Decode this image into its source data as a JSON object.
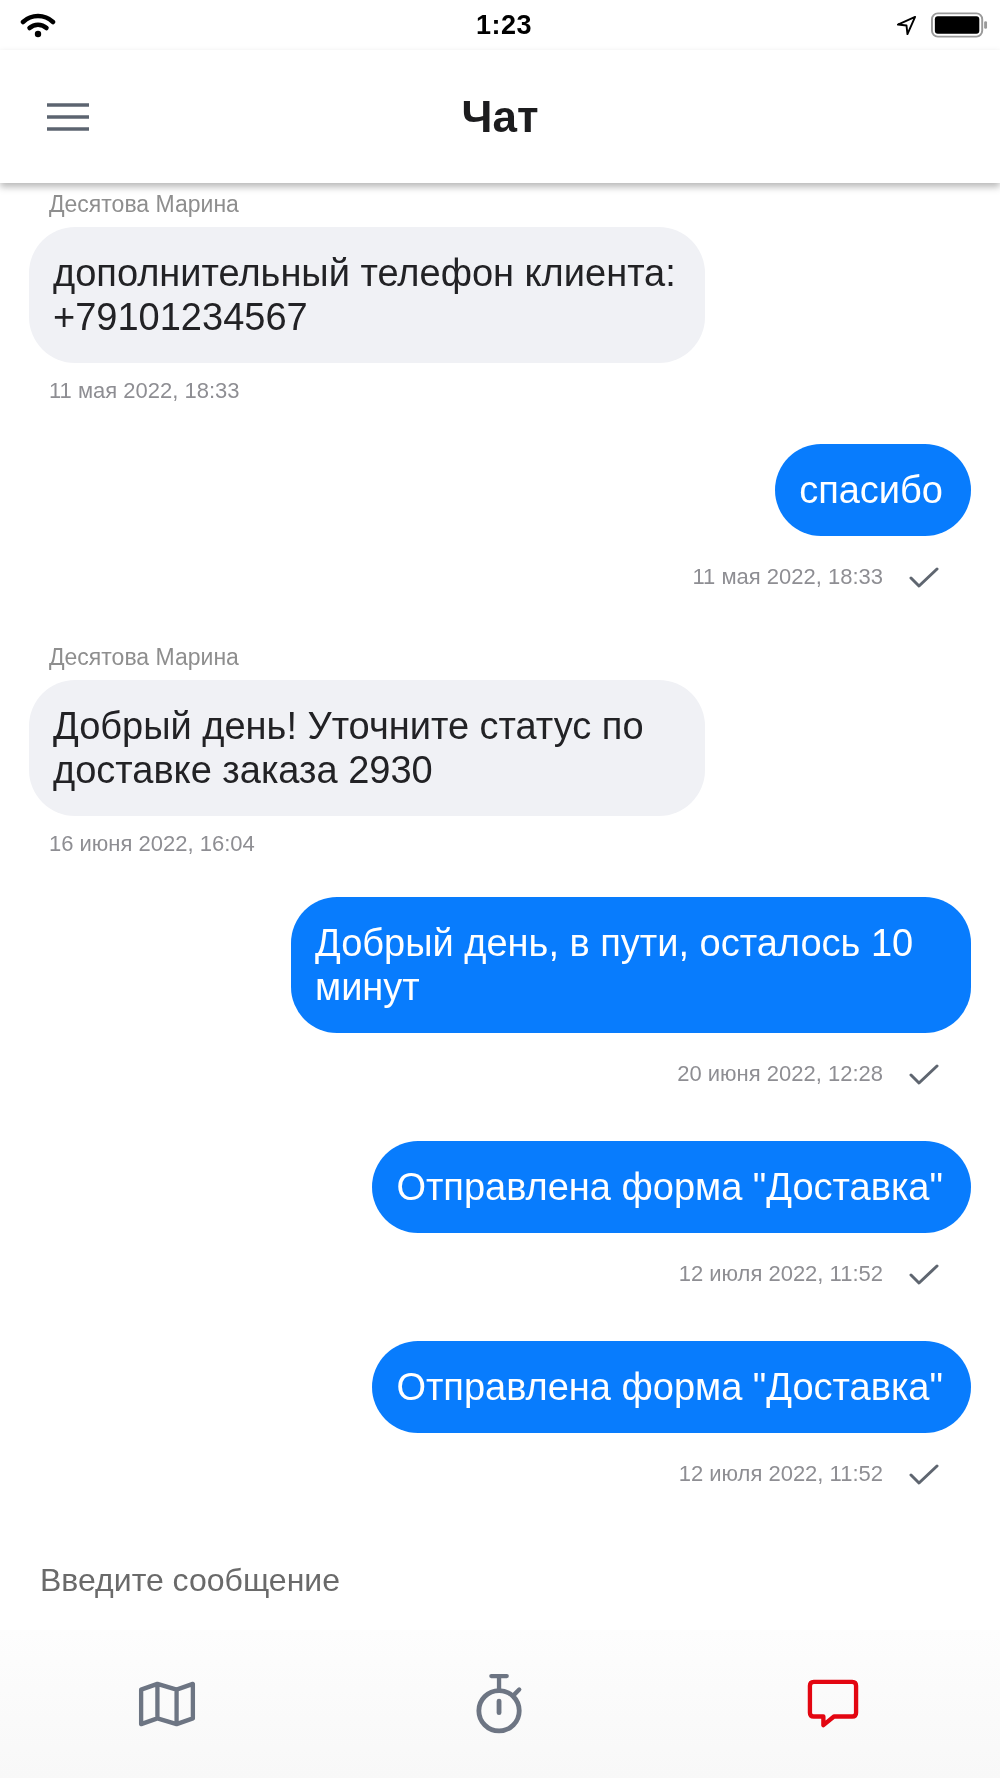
{
  "status_bar": {
    "time": "1:23"
  },
  "header": {
    "title": "Чат"
  },
  "messages": [
    {
      "kind": "incoming",
      "sender": "Десятова Марина",
      "text": "дополнительный телефон клиента: +79101234567",
      "time": "11 мая 2022, 18:33"
    },
    {
      "kind": "outgoing",
      "text": "спасибо",
      "time": "11 мая 2022, 18:33",
      "delivered": true
    },
    {
      "kind": "incoming",
      "sender": "Десятова Марина",
      "text": "Добрый день! Уточните статус по доставке заказа 2930",
      "time": "16 июня 2022, 16:04"
    },
    {
      "kind": "outgoing",
      "text": "Добрый день, в пути, осталось 10 минут",
      "time": "20 июня 2022, 12:28",
      "delivered": true
    },
    {
      "kind": "outgoing",
      "text": "Отправлена форма \"Доставка\"",
      "time": "12 июля 2022, 11:52",
      "delivered": true
    },
    {
      "kind": "outgoing",
      "text": "Отправлена форма \"Доставка\"",
      "time": "12 июля 2022, 11:52",
      "delivered": true
    }
  ],
  "composer": {
    "placeholder": "Введите сообщение"
  },
  "tabs": [
    {
      "selected": false
    },
    {
      "selected": false
    },
    {
      "selected": true
    }
  ]
}
